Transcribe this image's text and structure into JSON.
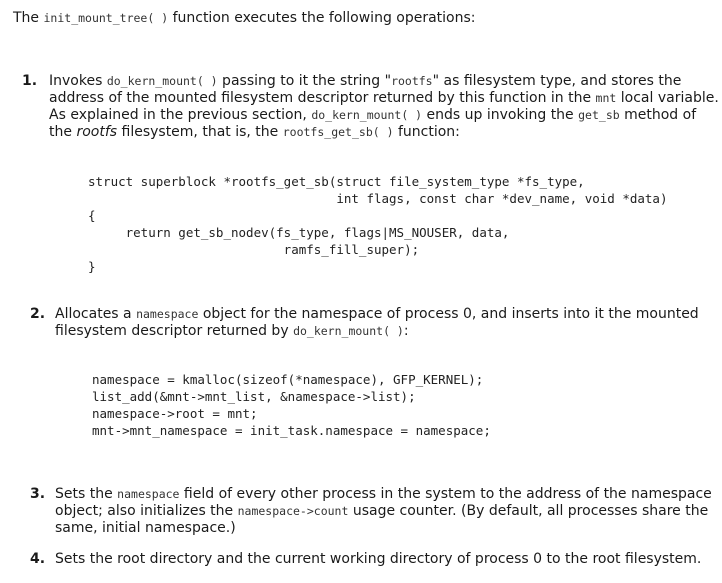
{
  "intro": {
    "prefix": "The ",
    "fn": "init_mount_tree( )",
    "suffix": " function executes the following operations:"
  },
  "items": [
    {
      "num": "1.",
      "lines": [
        [
          "Invokes ",
          {
            "code": "do_kern_mount( )"
          },
          " passing to it the string \"",
          {
            "code": "rootfs"
          },
          "\" as filesystem type, and stores the"
        ],
        [
          "address of the mounted filesystem descriptor returned by this function in the ",
          {
            "code": "mnt"
          },
          " local variable."
        ],
        [
          "As explained in the previous section, ",
          {
            "code": "do_kern_mount( )"
          },
          " ends up invoking the ",
          {
            "code": "get_sb"
          },
          " method of"
        ],
        [
          "the ",
          {
            "em": "rootfs"
          },
          " filesystem, that is, the ",
          {
            "code": "rootfs_get_sb( )"
          },
          " function:"
        ]
      ],
      "code_lines": [
        "struct superblock *rootfs_get_sb(struct file_system_type *fs_type,",
        "                                 int flags, const char *dev_name, void *data)",
        "{",
        "     return get_sb_nodev(fs_type, flags|MS_NOUSER, data,",
        "                          ramfs_fill_super);",
        "}"
      ]
    },
    {
      "num": "2.",
      "lines": [
        [
          "Allocates a ",
          {
            "code": "namespace"
          },
          " object for the namespace of process 0, and inserts into it the mounted"
        ],
        [
          "filesystem descriptor returned by ",
          {
            "code": "do_kern_mount( )"
          },
          ":"
        ]
      ],
      "code_lines": [
        "namespace = kmalloc(sizeof(*namespace), GFP_KERNEL);",
        "list_add(&mnt->mnt_list, &namespace->list);",
        "namespace->root = mnt;",
        "mnt->mnt_namespace = init_task.namespace = namespace;"
      ]
    },
    {
      "num": "3.",
      "lines": [
        [
          "Sets the ",
          {
            "code": "namespace"
          },
          " field of every other process in the system to the address of the namespace"
        ],
        [
          "object; also initializes the ",
          {
            "code": "namespace->count"
          },
          " usage counter. (By default, all processes share the"
        ],
        [
          "same, initial namespace.)"
        ]
      ]
    },
    {
      "num": "4.",
      "lines": [
        [
          "Sets the root directory and the current working directory of process 0 to the root filesystem."
        ]
      ]
    }
  ]
}
